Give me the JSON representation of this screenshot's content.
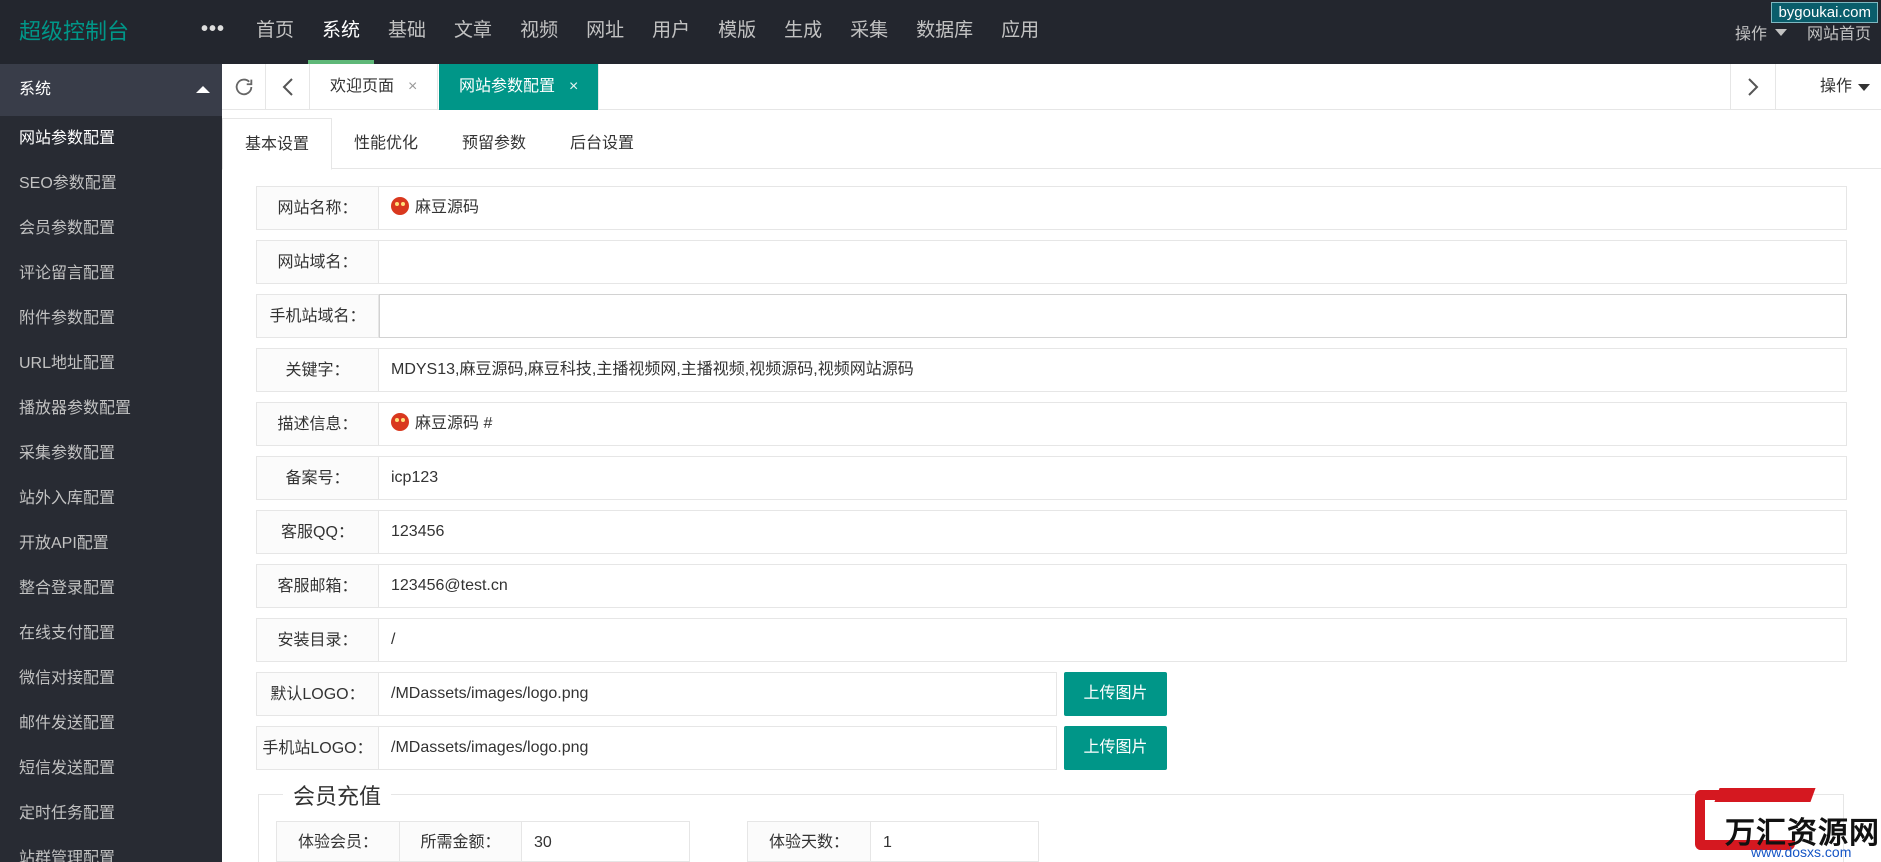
{
  "header": {
    "logo": "超级控制台",
    "more": "•••",
    "nav": [
      "首页",
      "系统",
      "基础",
      "文章",
      "视频",
      "网址",
      "用户",
      "模版",
      "生成",
      "采集",
      "数据库",
      "应用"
    ],
    "active_nav": "系统",
    "right_op": "操作",
    "site_home": "网站首页",
    "watermark": "bygoukai.com"
  },
  "sidebar": {
    "title": "系统",
    "items": [
      "网站参数配置",
      "SEO参数配置",
      "会员参数配置",
      "评论留言配置",
      "附件参数配置",
      "URL地址配置",
      "播放器参数配置",
      "采集参数配置",
      "站外入库配置",
      "开放API配置",
      "整合登录配置",
      "在线支付配置",
      "微信对接配置",
      "邮件发送配置",
      "短信发送配置",
      "定时任务配置",
      "站群管理配置"
    ]
  },
  "tabs": {
    "items": [
      {
        "label": "欢迎页面",
        "close": "×"
      },
      {
        "label": "网站参数配置",
        "close": "×"
      }
    ],
    "op": "操作"
  },
  "subtabs": [
    "基本设置",
    "性能优化",
    "预留参数",
    "后台设置"
  ],
  "form": {
    "site_name": {
      "label": "网站名称：",
      "value": "麻豆源码"
    },
    "site_domain": {
      "label": "网站域名：",
      "value": ""
    },
    "mobile_domain": {
      "label": "手机站域名：",
      "value": ""
    },
    "keywords": {
      "label": "关键字：",
      "value": "MDYS13,麻豆源码,麻豆科技,主播视频网,主播视频,视频源码,视频网站源码"
    },
    "description": {
      "label": "描述信息：",
      "value": "麻豆源码 #"
    },
    "icp": {
      "label": "备案号：",
      "value": "icp123"
    },
    "qq": {
      "label": "客服QQ：",
      "value": "123456"
    },
    "email": {
      "label": "客服邮箱：",
      "value": "123456@test.cn"
    },
    "install_dir": {
      "label": "安装目录：",
      "value": "/"
    },
    "logo": {
      "label": "默认LOGO：",
      "value": "/MDassets/images/logo.png",
      "button": "上传图片"
    },
    "mobile_logo": {
      "label": "手机站LOGO：",
      "value": "/MDassets/images/logo.png",
      "button": "上传图片"
    }
  },
  "member": {
    "legend": "会员充值",
    "trial": "体验会员：",
    "price_label": "所需金额：",
    "price": "30",
    "days_label": "体验天数：",
    "days": "1"
  },
  "brand": {
    "name": "万汇资源网",
    "url": "www.dosxs.com"
  },
  "colors": {
    "accent": "#009688",
    "header_bg": "#23262e",
    "sidebar_bg": "#282b33",
    "nav_indicator": "#5FB878"
  }
}
